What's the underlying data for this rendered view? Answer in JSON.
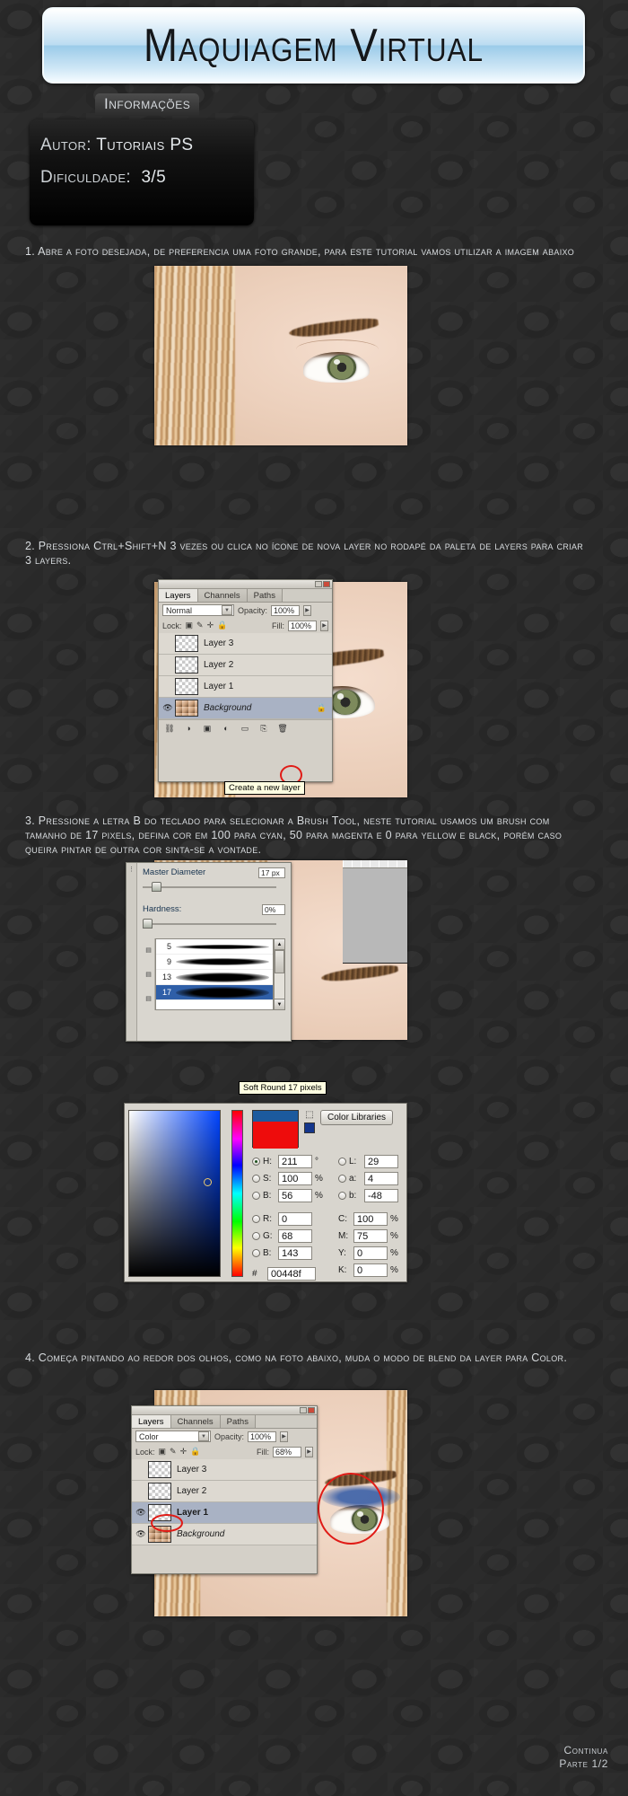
{
  "header": {
    "title": "Maquiagem Virtual"
  },
  "info": {
    "tab_label": "Informações",
    "author_label": "Autor:",
    "author_value": "Tutoriais PS",
    "difficulty_label": "Dificuldade:",
    "difficulty_value": "3/5"
  },
  "steps": [
    {
      "number": "1.",
      "text": "1. Abre a foto desejada, de preferencia uma foto grande, para este tutorial vamos utilizar a imagem abaixo"
    },
    {
      "number": "2.",
      "text": "2. Pressiona Ctrl+Shift+N 3 vezes ou clica no ícone de nova layer no rodapé da paleta de layers para criar 3 layers."
    },
    {
      "number": "3.",
      "text": "3. Pressione a letra B do teclado para selecionar a Brush Tool, neste tutorial usamos um brush com tamanho de 17 pixels, defina cor em 100 para cyan, 50 para magenta e 0 para yellow e black, porém caso queira pintar de outra cor sinta-se a vontade."
    },
    {
      "number": "4.",
      "text": "4. Começa pintando ao redor dos olhos, como na foto abaixo, muda o modo de blend da layer para Color."
    }
  ],
  "layers_panel_step2": {
    "tabs": [
      "Layers",
      "Channels",
      "Paths"
    ],
    "active_tab": "Layers",
    "blend_mode": "Normal",
    "opacity_label": "Opacity:",
    "opacity_value": "100%",
    "lock_label": "Lock:",
    "fill_label": "Fill:",
    "fill_value": "100%",
    "rows": [
      {
        "name": "Layer 3",
        "visible": false,
        "kind": "empty",
        "selected": false
      },
      {
        "name": "Layer 2",
        "visible": false,
        "kind": "empty",
        "selected": false
      },
      {
        "name": "Layer 1",
        "visible": false,
        "kind": "empty",
        "selected": false
      },
      {
        "name": "Background",
        "visible": true,
        "kind": "photo",
        "selected": true,
        "locked": true
      }
    ],
    "tooltip": "Create a new layer"
  },
  "brush_panel": {
    "master_diameter_label": "Master Diameter",
    "master_diameter_value": "17 px",
    "hardness_label": "Hardness:",
    "hardness_value": "0%",
    "sizes": [
      "5",
      "9",
      "13",
      "17"
    ],
    "selected_size": "17",
    "tooltip": "Soft Round 17 pixels"
  },
  "color_picker": {
    "color_libraries_label": "Color Libraries",
    "hex_prefix": "#",
    "hex_value": "00448f",
    "fields": [
      {
        "label": "H:",
        "value": "211",
        "unit": "°",
        "selected": true
      },
      {
        "label": "S:",
        "value": "100",
        "unit": "%",
        "selected": false
      },
      {
        "label": "B:",
        "value": "56",
        "unit": "%",
        "selected": false
      },
      {
        "label": "R:",
        "value": "0",
        "unit": "",
        "selected": false
      },
      {
        "label": "G:",
        "value": "68",
        "unit": "",
        "selected": false
      },
      {
        "label": "B:",
        "value": "143",
        "unit": "",
        "selected": false
      }
    ],
    "lab_fields": [
      {
        "label": "L:",
        "value": "29",
        "unit": ""
      },
      {
        "label": "a:",
        "value": "4",
        "unit": ""
      },
      {
        "label": "b:",
        "value": "-48",
        "unit": ""
      }
    ],
    "cmyk_fields": [
      {
        "label": "C:",
        "value": "100",
        "unit": "%"
      },
      {
        "label": "M:",
        "value": "75",
        "unit": "%"
      },
      {
        "label": "Y:",
        "value": "0",
        "unit": "%"
      },
      {
        "label": "K:",
        "value": "0",
        "unit": "%"
      }
    ]
  },
  "layers_panel_step4": {
    "tabs": [
      "Layers",
      "Channels",
      "Paths"
    ],
    "active_tab": "Layers",
    "blend_mode": "Color",
    "opacity_label": "Opacity:",
    "opacity_value": "100%",
    "lock_label": "Lock:",
    "fill_label": "Fill:",
    "fill_value": "68%",
    "rows": [
      {
        "name": "Layer 3",
        "visible": false,
        "kind": "empty",
        "selected": false
      },
      {
        "name": "Layer 2",
        "visible": false,
        "kind": "empty",
        "selected": false
      },
      {
        "name": "Layer 1",
        "visible": true,
        "kind": "empty",
        "selected": true
      },
      {
        "name": "Background",
        "visible": true,
        "kind": "photo",
        "selected": false
      }
    ]
  },
  "footer": {
    "line1": "Continua",
    "line2": "Parte 1/2"
  }
}
